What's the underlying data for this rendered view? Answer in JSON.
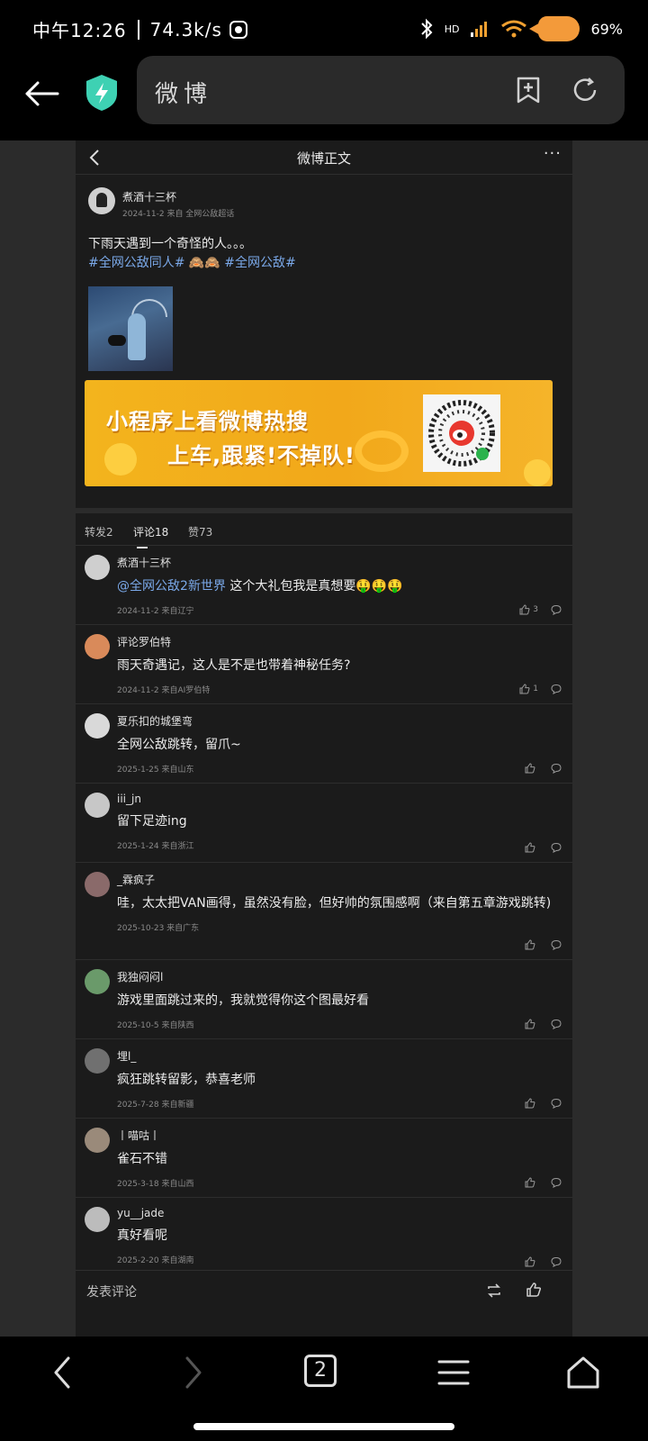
{
  "status_bar": {
    "time": "中午12:26",
    "speed": "74.3k/s",
    "battery": "69%",
    "network_badge": "HD"
  },
  "browser": {
    "url_text": "微博"
  },
  "weibo": {
    "nav_title": "微博正文",
    "post": {
      "user": "煮酒十三杯",
      "meta": "2024-11-2  来自 全网公敌超话",
      "text": "下雨天遇到一个奇怪的人。。。",
      "tag1": "#全网公敌同人#",
      "emoji": "🙈🙈",
      "tag2": "#全网公敌#"
    },
    "banner": {
      "line1": "小程序上看微博热搜",
      "line2": "上车,跟紧!不掉队!"
    },
    "tabs": {
      "reposts": "转发2",
      "comments": "评论18",
      "likes": "赞73"
    },
    "comments": [
      {
        "name": "煮酒十三杯",
        "mention": "@全网公敌2新世界",
        "text": " 这个大礼包我是真想要🤑🤑🤑",
        "meta": "2024-11-2 来自辽宁",
        "likes": "3"
      },
      {
        "name": "评论罗伯特",
        "mention": "",
        "text": "雨天奇遇记，这人是不是也带着神秘任务?",
        "meta": "2024-11-2 来自AI罗伯特",
        "likes": "1"
      },
      {
        "name": "夏乐扣的城堡弯",
        "mention": "",
        "text": "全网公敌跳转，留爪~",
        "meta": "2025-1-25 来自山东",
        "likes": ""
      },
      {
        "name": "iii_jn",
        "mention": "",
        "text": "留下足迹ing",
        "meta": "2025-1-24 来自浙江",
        "likes": ""
      },
      {
        "name": "_霖疯子",
        "mention": "",
        "text": "哇，太太把VAN画得，虽然没有脸，但好帅的氛围感啊（来自第五章游戏跳转)",
        "meta": "2025-10-23 来自广东",
        "likes": ""
      },
      {
        "name": "我独闷闷l",
        "mention": "",
        "text": "游戏里面跳过来的，我就觉得你这个图最好看",
        "meta": "2025-10-5 来自陕西",
        "likes": ""
      },
      {
        "name": "埋l_",
        "mention": "",
        "text": "疯狂跳转留影，恭喜老师",
        "meta": "2025-7-28 来自新疆",
        "likes": ""
      },
      {
        "name": "丨喵咕丨",
        "mention": "",
        "text": "雀石不错",
        "meta": "2025-3-18 来自山西",
        "likes": ""
      },
      {
        "name": "yu__jade",
        "mention": "",
        "text": "真好看呢",
        "meta": "2025-2-20 来自湖南",
        "likes": ""
      }
    ],
    "footer": {
      "comment_placeholder": "发表评论"
    }
  },
  "bottom_nav": {
    "tab_count": "2"
  },
  "icons": [
    "back-arrow-icon",
    "shield-bolt-icon",
    "bookmark-add-icon",
    "refresh-icon",
    "more-icon",
    "like-icon",
    "comment-icon",
    "repost-icon",
    "forward-icon",
    "tabs-icon",
    "menu-icon",
    "home-icon"
  ]
}
